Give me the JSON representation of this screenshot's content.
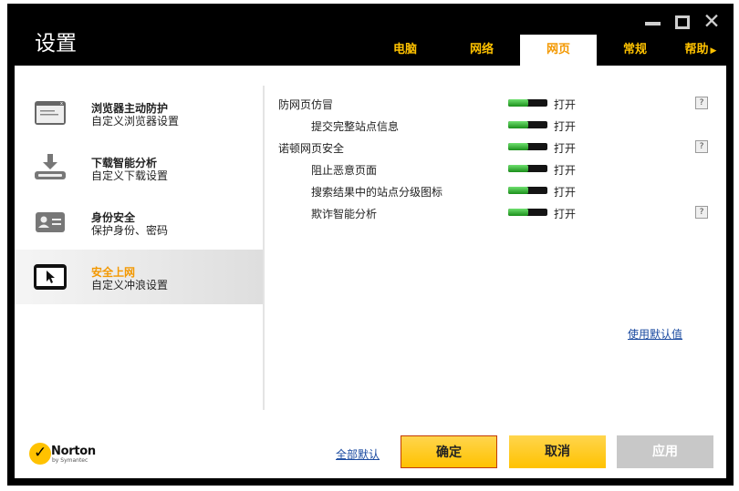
{
  "window": {
    "title": "设置"
  },
  "tabs": [
    {
      "label": "电脑",
      "active": false
    },
    {
      "label": "网络",
      "active": false
    },
    {
      "label": "网页",
      "active": true
    },
    {
      "label": "常规",
      "active": false
    },
    {
      "label": "帮助",
      "active": false
    }
  ],
  "sidebar": {
    "items": [
      {
        "title": "浏览器主动防护",
        "subtitle": "自定义浏览器设置",
        "icon": "browser-window-icon",
        "active": false
      },
      {
        "title": "下载智能分析",
        "subtitle": "自定义下载设置",
        "icon": "download-icon",
        "active": false
      },
      {
        "title": "身份安全",
        "subtitle": "保护身份、密码",
        "icon": "id-card-icon",
        "active": false
      },
      {
        "title": "安全上网",
        "subtitle": "自定义冲浪设置",
        "icon": "cursor-screen-icon",
        "active": true
      }
    ]
  },
  "settings": [
    {
      "label": "防网页仿冒",
      "state": "打开",
      "on": true,
      "indent": false,
      "help": "?"
    },
    {
      "label": "提交完整站点信息",
      "state": "打开",
      "on": true,
      "indent": true,
      "help": ""
    },
    {
      "label": "诺顿网页安全",
      "state": "打开",
      "on": true,
      "indent": false,
      "help": "?"
    },
    {
      "label": "阻止恶意页面",
      "state": "打开",
      "on": true,
      "indent": true,
      "help": ""
    },
    {
      "label": "搜索结果中的站点分级图标",
      "state": "打开",
      "on": true,
      "indent": true,
      "help": ""
    },
    {
      "label": "欺诈智能分析",
      "state": "打开",
      "on": true,
      "indent": true,
      "help": "?"
    }
  ],
  "links": {
    "use_defaults": "使用默认值",
    "all_defaults": "全部默认"
  },
  "buttons": {
    "ok": "确定",
    "cancel": "取消",
    "apply": "应用"
  },
  "brand": {
    "name": "Norton",
    "sub": "by Symantec",
    "accent": "#ffc200",
    "tab_active_text": "#f39800"
  }
}
